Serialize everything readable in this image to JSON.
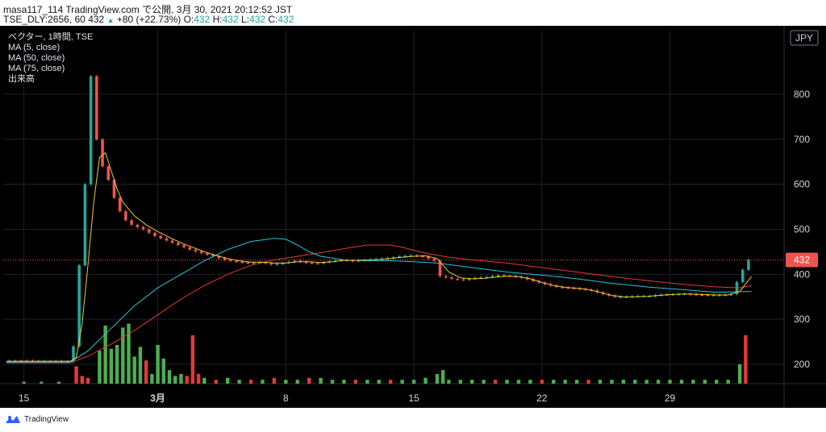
{
  "header": {
    "line1": "masa117_114 TradingView.com で公開, 3月 30, 2021 20:12:52 JST",
    "symbol": "TSE_DLY:2656, 60",
    "price": "432",
    "change": "+80 (+22.73%)",
    "o_label": "O:",
    "o_value": "432",
    "h_label": "H:",
    "h_value": "432",
    "l_label": "L:",
    "l_value": "432",
    "c_label": "C:",
    "c_value": "432"
  },
  "legend": {
    "title": "ベクター, 1時間, TSE",
    "ma5": "MA (5, close)",
    "ma50": "MA (50, close)",
    "ma75": "MA (75, close)",
    "volume": "出来高"
  },
  "footer": {
    "brand": "TradingView",
    "logo_icon": "tradingview-logo-icon"
  },
  "chart_data": {
    "type": "candlestick",
    "currency": "JPY",
    "y_ticks": [
      800,
      700,
      600,
      500,
      400,
      300,
      200
    ],
    "ylim": [
      170,
      860
    ],
    "x_ticks": [
      "15",
      "3月",
      "8",
      "15",
      "22",
      "29"
    ],
    "last_price_label": "432",
    "colors": {
      "up": "#26a69a",
      "down": "#ef5350",
      "ma5": "#f0c930",
      "ma50": "#26c6da",
      "ma75": "#e53935",
      "vol_up": "#4caf50",
      "vol_down": "#e53935"
    },
    "price_path": [
      [
        0,
        208
      ],
      [
        3,
        208
      ],
      [
        6,
        207
      ],
      [
        9,
        207
      ],
      [
        11,
        206
      ],
      [
        12,
        240
      ],
      [
        13,
        420
      ],
      [
        14,
        600
      ],
      [
        15,
        840
      ],
      [
        16,
        700
      ],
      [
        17,
        640
      ],
      [
        18,
        610
      ],
      [
        19,
        570
      ],
      [
        20,
        540
      ],
      [
        21,
        520
      ],
      [
        22,
        510
      ],
      [
        24,
        500
      ],
      [
        26,
        485
      ],
      [
        28,
        475
      ],
      [
        30,
        465
      ],
      [
        32,
        455
      ],
      [
        34,
        447
      ],
      [
        36,
        440
      ],
      [
        38,
        432
      ],
      [
        40,
        428
      ],
      [
        42,
        425
      ],
      [
        44,
        427
      ],
      [
        46,
        422
      ],
      [
        48,
        425
      ],
      [
        50,
        430
      ],
      [
        52,
        426
      ],
      [
        54,
        424
      ],
      [
        56,
        429
      ],
      [
        58,
        432
      ],
      [
        60,
        430
      ],
      [
        62,
        432
      ],
      [
        64,
        434
      ],
      [
        66,
        436
      ],
      [
        68,
        440
      ],
      [
        70,
        442
      ],
      [
        72,
        440
      ],
      [
        74,
        430
      ],
      [
        75,
        396
      ],
      [
        77,
        390
      ],
      [
        79,
        388
      ],
      [
        81,
        392
      ],
      [
        83,
        394
      ],
      [
        85,
        398
      ],
      [
        87,
        396
      ],
      [
        89,
        393
      ],
      [
        91,
        385
      ],
      [
        93,
        378
      ],
      [
        95,
        372
      ],
      [
        97,
        370
      ],
      [
        99,
        368
      ],
      [
        101,
        364
      ],
      [
        103,
        356
      ],
      [
        105,
        350
      ],
      [
        107,
        350
      ],
      [
        109,
        352
      ],
      [
        111,
        352
      ],
      [
        113,
        355
      ],
      [
        115,
        356
      ],
      [
        117,
        357
      ],
      [
        119,
        355
      ],
      [
        121,
        354
      ],
      [
        123,
        354
      ],
      [
        125,
        356
      ],
      [
        127,
        410
      ],
      [
        128,
        432
      ]
    ],
    "ma5_path": [
      [
        0,
        207
      ],
      [
        11,
        207
      ],
      [
        12,
        215
      ],
      [
        13,
        290
      ],
      [
        14,
        420
      ],
      [
        15,
        560
      ],
      [
        16,
        660
      ],
      [
        17,
        670
      ],
      [
        18,
        630
      ],
      [
        19,
        590
      ],
      [
        20,
        560
      ],
      [
        22,
        530
      ],
      [
        24,
        510
      ],
      [
        26,
        495
      ],
      [
        28,
        482
      ],
      [
        30,
        470
      ],
      [
        32,
        460
      ],
      [
        34,
        450
      ],
      [
        36,
        442
      ],
      [
        38,
        435
      ],
      [
        40,
        430
      ],
      [
        42,
        427
      ],
      [
        44,
        427
      ],
      [
        46,
        425
      ],
      [
        48,
        425
      ],
      [
        50,
        428
      ],
      [
        52,
        428
      ],
      [
        54,
        426
      ],
      [
        56,
        428
      ],
      [
        58,
        431
      ],
      [
        60,
        431
      ],
      [
        62,
        432
      ],
      [
        64,
        433
      ],
      [
        66,
        435
      ],
      [
        68,
        438
      ],
      [
        70,
        440
      ],
      [
        72,
        441
      ],
      [
        74,
        435
      ],
      [
        76,
        405
      ],
      [
        78,
        392
      ],
      [
        80,
        390
      ],
      [
        82,
        391
      ],
      [
        84,
        394
      ],
      [
        86,
        396
      ],
      [
        88,
        395
      ],
      [
        90,
        390
      ],
      [
        92,
        382
      ],
      [
        94,
        375
      ],
      [
        96,
        371
      ],
      [
        98,
        369
      ],
      [
        100,
        366
      ],
      [
        102,
        360
      ],
      [
        104,
        353
      ],
      [
        106,
        350
      ],
      [
        108,
        350
      ],
      [
        110,
        351
      ],
      [
        112,
        353
      ],
      [
        114,
        355
      ],
      [
        116,
        356
      ],
      [
        118,
        356
      ],
      [
        120,
        355
      ],
      [
        122,
        354
      ],
      [
        124,
        354
      ],
      [
        126,
        362
      ],
      [
        128,
        395
      ]
    ],
    "ma50_path": [
      [
        0,
        205
      ],
      [
        11,
        205
      ],
      [
        14,
        230
      ],
      [
        18,
        280
      ],
      [
        22,
        330
      ],
      [
        26,
        370
      ],
      [
        30,
        400
      ],
      [
        34,
        430
      ],
      [
        38,
        455
      ],
      [
        42,
        473
      ],
      [
        46,
        480
      ],
      [
        48,
        478
      ],
      [
        50,
        465
      ],
      [
        52,
        450
      ],
      [
        54,
        440
      ],
      [
        58,
        432
      ],
      [
        62,
        430
      ],
      [
        66,
        430
      ],
      [
        70,
        428
      ],
      [
        74,
        425
      ],
      [
        80,
        415
      ],
      [
        86,
        405
      ],
      [
        92,
        398
      ],
      [
        98,
        390
      ],
      [
        104,
        380
      ],
      [
        110,
        372
      ],
      [
        116,
        366
      ],
      [
        122,
        360
      ],
      [
        128,
        362
      ]
    ],
    "ma75_path": [
      [
        0,
        203
      ],
      [
        11,
        203
      ],
      [
        14,
        218
      ],
      [
        18,
        245
      ],
      [
        22,
        275
      ],
      [
        26,
        310
      ],
      [
        30,
        345
      ],
      [
        34,
        375
      ],
      [
        38,
        400
      ],
      [
        42,
        420
      ],
      [
        46,
        432
      ],
      [
        50,
        440
      ],
      [
        54,
        448
      ],
      [
        58,
        457
      ],
      [
        62,
        465
      ],
      [
        66,
        465
      ],
      [
        68,
        460
      ],
      [
        72,
        447
      ],
      [
        76,
        438
      ],
      [
        80,
        432
      ],
      [
        86,
        425
      ],
      [
        92,
        415
      ],
      [
        98,
        405
      ],
      [
        104,
        395
      ],
      [
        110,
        386
      ],
      [
        116,
        378
      ],
      [
        122,
        372
      ],
      [
        126,
        370
      ],
      [
        128,
        375
      ]
    ],
    "volume": [
      [
        3,
        2,
        0
      ],
      [
        6,
        2,
        0
      ],
      [
        9,
        2,
        0
      ],
      [
        12,
        18,
        1
      ],
      [
        13,
        8,
        1
      ],
      [
        14,
        6,
        1
      ],
      [
        16,
        34,
        0
      ],
      [
        17,
        60,
        0
      ],
      [
        18,
        36,
        0
      ],
      [
        19,
        40,
        0
      ],
      [
        20,
        58,
        0
      ],
      [
        21,
        62,
        0
      ],
      [
        22,
        28,
        0
      ],
      [
        23,
        38,
        0
      ],
      [
        24,
        24,
        1
      ],
      [
        25,
        10,
        0
      ],
      [
        26,
        40,
        0
      ],
      [
        27,
        26,
        0
      ],
      [
        28,
        14,
        0
      ],
      [
        29,
        8,
        0
      ],
      [
        30,
        10,
        0
      ],
      [
        31,
        8,
        1
      ],
      [
        32,
        50,
        1
      ],
      [
        33,
        10,
        1
      ],
      [
        34,
        6,
        0
      ],
      [
        36,
        4,
        1
      ],
      [
        38,
        6,
        0
      ],
      [
        40,
        4,
        0
      ],
      [
        42,
        4,
        1
      ],
      [
        44,
        4,
        0
      ],
      [
        46,
        6,
        1
      ],
      [
        48,
        4,
        0
      ],
      [
        50,
        4,
        0
      ],
      [
        52,
        6,
        1
      ],
      [
        54,
        6,
        0
      ],
      [
        56,
        4,
        0
      ],
      [
        58,
        4,
        0
      ],
      [
        60,
        4,
        1
      ],
      [
        62,
        4,
        0
      ],
      [
        64,
        4,
        0
      ],
      [
        66,
        4,
        1
      ],
      [
        68,
        4,
        0
      ],
      [
        70,
        4,
        0
      ],
      [
        72,
        6,
        0
      ],
      [
        74,
        10,
        0
      ],
      [
        75,
        14,
        0
      ],
      [
        76,
        4,
        0
      ],
      [
        78,
        4,
        0
      ],
      [
        80,
        4,
        0
      ],
      [
        82,
        4,
        0
      ],
      [
        84,
        4,
        1
      ],
      [
        86,
        4,
        0
      ],
      [
        88,
        4,
        0
      ],
      [
        90,
        4,
        0
      ],
      [
        92,
        4,
        1
      ],
      [
        94,
        4,
        0
      ],
      [
        96,
        4,
        0
      ],
      [
        98,
        4,
        0
      ],
      [
        100,
        4,
        1
      ],
      [
        102,
        4,
        0
      ],
      [
        104,
        4,
        0
      ],
      [
        106,
        4,
        0
      ],
      [
        108,
        4,
        0
      ],
      [
        110,
        4,
        0
      ],
      [
        112,
        4,
        0
      ],
      [
        114,
        4,
        0
      ],
      [
        116,
        4,
        0
      ],
      [
        118,
        4,
        0
      ],
      [
        120,
        4,
        0
      ],
      [
        122,
        4,
        0
      ],
      [
        124,
        4,
        0
      ],
      [
        126,
        20,
        0
      ],
      [
        127,
        50,
        1
      ]
    ]
  }
}
